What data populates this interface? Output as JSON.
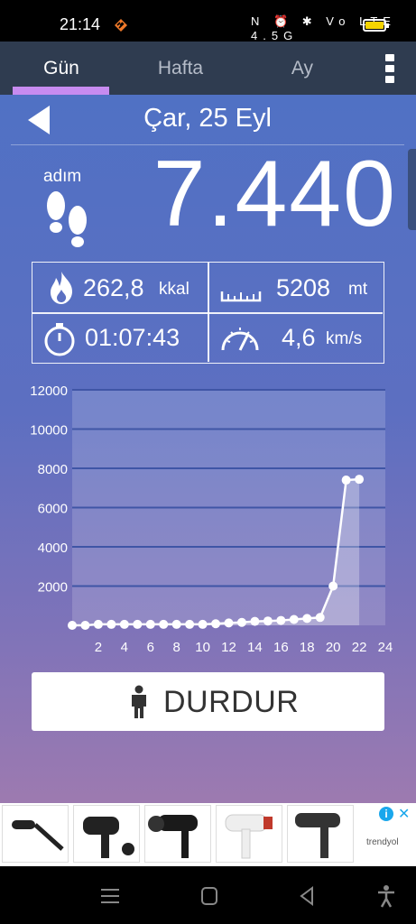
{
  "status_bar": {
    "time": "21:14",
    "system_icons": "N ⏰ ✱ Vo LTE 4.5G",
    "battery_color": "#f5d400"
  },
  "tabs": [
    {
      "label": "Gün",
      "active": true
    },
    {
      "label": "Hafta",
      "active": false
    },
    {
      "label": "Ay",
      "active": false
    }
  ],
  "date": "Çar, 25 Eyl",
  "steps": {
    "label": "adım",
    "value": "7.440"
  },
  "stats": {
    "calories": {
      "value": "262,8",
      "unit": "kkal",
      "icon": "flame-icon"
    },
    "distance": {
      "value": "5208",
      "unit": "mt",
      "icon": "ruler-icon"
    },
    "duration": {
      "value": "01:07:43",
      "icon": "stopwatch-icon"
    },
    "speed": {
      "value": "4,6",
      "unit": "km/s",
      "icon": "speedometer-icon"
    }
  },
  "chart_data": {
    "type": "area",
    "x": [
      0,
      1,
      2,
      3,
      4,
      5,
      6,
      7,
      8,
      9,
      10,
      11,
      12,
      13,
      14,
      15,
      16,
      17,
      18,
      19,
      20,
      21,
      22
    ],
    "values": [
      0,
      0,
      50,
      50,
      50,
      50,
      50,
      50,
      50,
      50,
      50,
      80,
      120,
      150,
      200,
      220,
      250,
      300,
      350,
      400,
      2000,
      7400,
      7440
    ],
    "ylim": [
      0,
      12000
    ],
    "xlim": [
      0,
      24
    ],
    "y_ticks": [
      "12000",
      "10000",
      "8000",
      "6000",
      "4000",
      "2000"
    ],
    "x_ticks": [
      "2",
      "4",
      "6",
      "8",
      "10",
      "12",
      "14",
      "16",
      "18",
      "20",
      "22",
      "24"
    ],
    "grid": true
  },
  "stop_button": {
    "label": "DURDUR",
    "icon": "person-icon"
  },
  "ad": {
    "info": "i",
    "close": "✕",
    "brand": "trendyol"
  },
  "colors": {
    "tab_bar": "#2f3c50",
    "tab_underline": "#c78bf0",
    "bg_top": "#5071c4",
    "bg_bottom": "#9d7ab0"
  }
}
